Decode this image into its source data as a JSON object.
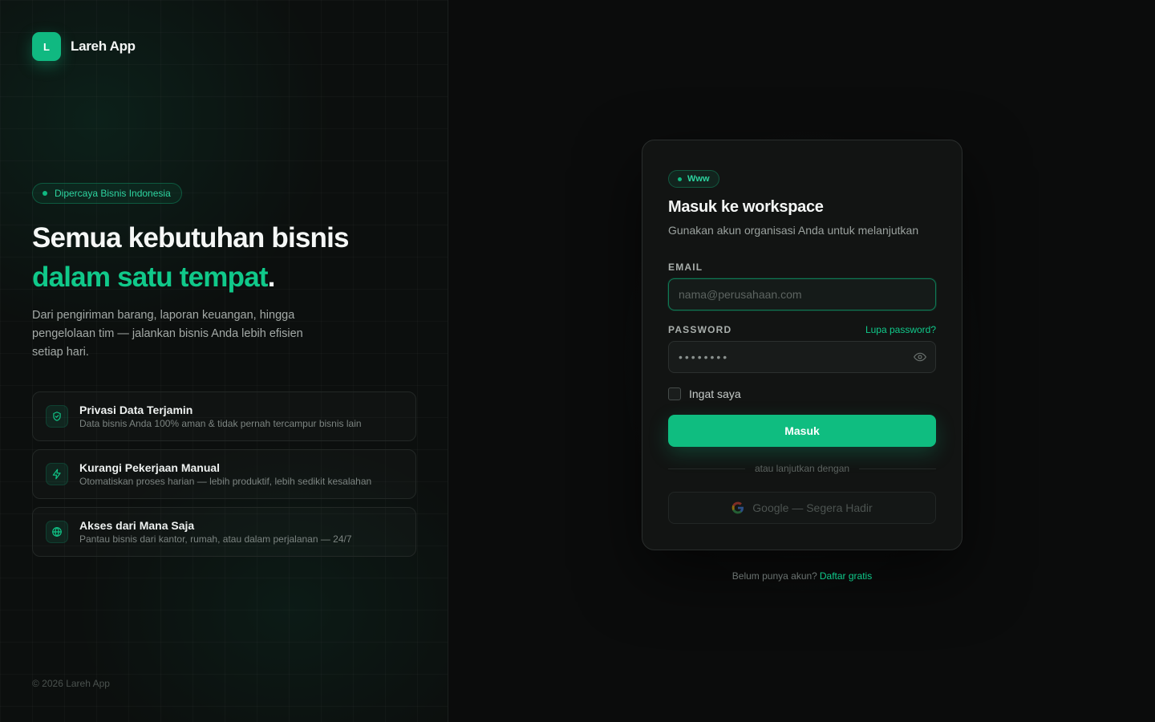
{
  "brand": {
    "logo_letter": "L",
    "name": "Lareh App"
  },
  "hero": {
    "badge": "Dipercaya Bisnis Indonesia",
    "headline_line1": "Semua kebutuhan bisnis",
    "headline_line2": "dalam satu tempat",
    "headline_period": ".",
    "description": "Dari pengiriman barang, laporan keuangan, hingga pengelolaan tim — jalankan bisnis Anda lebih efisien setiap hari."
  },
  "features": [
    {
      "icon": "shield-icon",
      "title": "Privasi Data Terjamin",
      "desc": "Data bisnis Anda 100% aman & tidak pernah tercampur bisnis lain"
    },
    {
      "icon": "lightning-icon",
      "title": "Kurangi Pekerjaan Manual",
      "desc": "Otomatiskan proses harian — lebih produktif, lebih sedikit kesalahan"
    },
    {
      "icon": "globe-icon",
      "title": "Akses dari Mana Saja",
      "desc": "Pantau bisnis dari kantor, rumah, atau dalam perjalanan — 24/7"
    }
  ],
  "footer": {
    "copyright": "© 2026 Lareh App"
  },
  "login": {
    "chip": "Www",
    "title": "Masuk ke workspace",
    "subtitle": "Gunakan akun organisasi Anda untuk melanjutkan",
    "email_label": "EMAIL",
    "email_placeholder": "nama@perusahaan.com",
    "password_label": "PASSWORD",
    "forgot_link": "Lupa password?",
    "password_value": "••••••••",
    "remember_label": "Ingat saya",
    "submit_label": "Masuk",
    "divider_text": "atau lanjutkan dengan",
    "google_label": "Google — Segera Hadir",
    "signup_prompt": "Belum punya akun?",
    "signup_link": "Daftar gratis"
  },
  "colors": {
    "accent": "#10b981",
    "background": "#0b0c0c",
    "card": "#121413"
  }
}
